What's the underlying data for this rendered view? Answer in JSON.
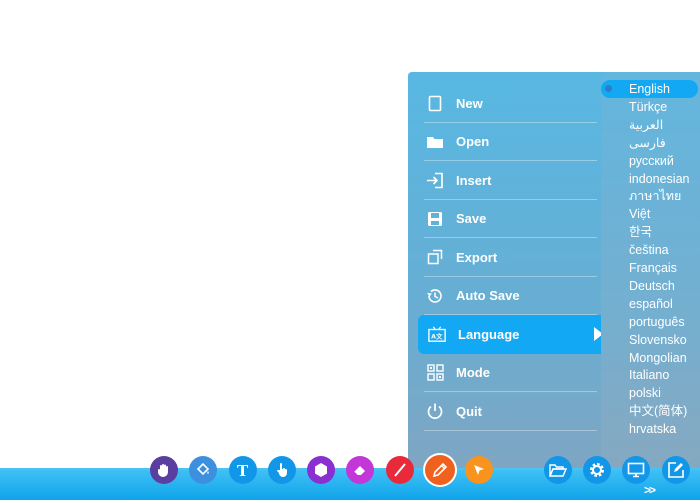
{
  "menu": {
    "items": [
      {
        "label": "New",
        "icon": "new-file-icon"
      },
      {
        "label": "Open",
        "icon": "folder-icon"
      },
      {
        "label": "Insert",
        "icon": "insert-icon"
      },
      {
        "label": "Save",
        "icon": "save-icon"
      },
      {
        "label": "Export",
        "icon": "export-icon"
      },
      {
        "label": "Auto Save",
        "icon": "auto-save-icon"
      },
      {
        "label": "Language",
        "icon": "language-icon",
        "active": true
      },
      {
        "label": "Mode",
        "icon": "mode-icon"
      },
      {
        "label": "Quit",
        "icon": "power-icon"
      }
    ]
  },
  "language": {
    "selected": "English",
    "options": [
      "English",
      "Türkçe",
      "العربية",
      "فارسی",
      "русский",
      "indonesian",
      "ภาษาไทย",
      "Việt",
      "한국",
      "čeština",
      "Français",
      "Deutsch",
      "español",
      "português",
      "Slovensko",
      "Mongolian",
      "Italiano",
      "polski",
      "中文(简体)",
      "hrvatska"
    ]
  },
  "toolbar": {
    "tools": [
      {
        "name": "hand-tool",
        "icon": "hand-icon",
        "color": "#5a3fa0"
      },
      {
        "name": "fill-tool",
        "icon": "paint-bucket-icon",
        "color": "#3d8fe0"
      },
      {
        "name": "text-tool",
        "icon": "text-icon",
        "color": "#1296e8"
      },
      {
        "name": "pointer-tool",
        "icon": "pointer-hand-icon",
        "color": "#1296e8"
      },
      {
        "name": "shape-tool",
        "icon": "hexagon-icon",
        "color": "#8a2fd0"
      },
      {
        "name": "eraser-tool",
        "icon": "eraser-icon",
        "color": "#c336d8"
      },
      {
        "name": "line-tool",
        "icon": "line-icon",
        "color": "#e82a3a"
      },
      {
        "name": "pen-tool",
        "icon": "pencil-icon",
        "color": "#f0611e"
      },
      {
        "name": "select-tool",
        "icon": "cursor-arrow-icon",
        "color": "#f8941e"
      }
    ],
    "right_tools": [
      {
        "name": "open-folder",
        "icon": "open-folder-icon",
        "color": "#1296e8"
      },
      {
        "name": "settings",
        "icon": "gear-icon",
        "color": "#1296e8"
      },
      {
        "name": "display",
        "icon": "monitor-icon",
        "color": "#1296e8"
      },
      {
        "name": "edit",
        "icon": "edit-square-icon",
        "color": "#1296e8"
      }
    ],
    "expand_label": ">>"
  }
}
